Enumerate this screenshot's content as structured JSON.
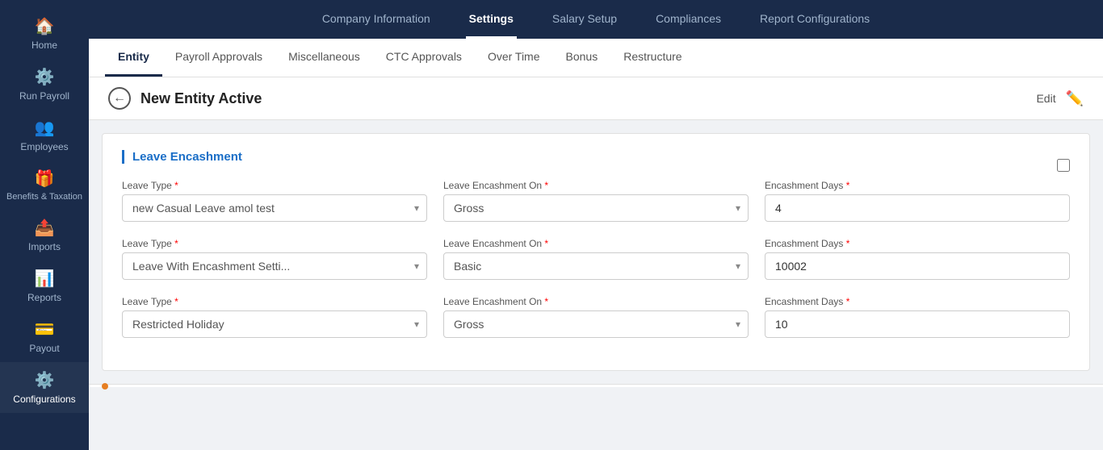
{
  "sidebar": {
    "items": [
      {
        "label": "Home",
        "icon": "🏠",
        "active": false
      },
      {
        "label": "Run Payroll",
        "icon": "⚙️",
        "active": false
      },
      {
        "label": "Employees",
        "icon": "👥",
        "active": false
      },
      {
        "label": "Benefits & Taxation",
        "icon": "🎁",
        "active": false
      },
      {
        "label": "Imports",
        "icon": "📤",
        "active": false
      },
      {
        "label": "Reports",
        "icon": "📊",
        "active": false
      },
      {
        "label": "Payout",
        "icon": "💳",
        "active": false
      },
      {
        "label": "Configurations",
        "icon": "⚙️",
        "active": true
      }
    ]
  },
  "topNav": {
    "items": [
      {
        "label": "Company Information",
        "active": false
      },
      {
        "label": "Settings",
        "active": true
      },
      {
        "label": "Salary Setup",
        "active": false
      },
      {
        "label": "Compliances",
        "active": false
      },
      {
        "label": "Report Configurations",
        "active": false
      }
    ]
  },
  "subNav": {
    "items": [
      {
        "label": "Entity",
        "active": true
      },
      {
        "label": "Payroll Approvals",
        "active": false
      },
      {
        "label": "Miscellaneous",
        "active": false
      },
      {
        "label": "CTC Approvals",
        "active": false
      },
      {
        "label": "Over Time",
        "active": false
      },
      {
        "label": "Bonus",
        "active": false
      },
      {
        "label": "Restructure",
        "active": false
      }
    ]
  },
  "entityHeader": {
    "title": "New Entity Active",
    "editLabel": "Edit"
  },
  "leaveEncashment": {
    "title": "Leave Encashment",
    "rows": [
      {
        "leaveTypeLabel": "Leave Type",
        "leaveTypeValue": "new Casual Leave amol test",
        "encashmentOnLabel": "Leave Encashment On",
        "encashmentOnValue": "Gross",
        "encashmentDaysLabel": "Encashment Days",
        "encashmentDaysValue": "4"
      },
      {
        "leaveTypeLabel": "Leave Type",
        "leaveTypeValue": "Leave With Encashment Setti...",
        "encashmentOnLabel": "Leave Encashment On",
        "encashmentOnValue": "Basic",
        "encashmentDaysLabel": "Encashment Days",
        "encashmentDaysValue": "10002"
      },
      {
        "leaveTypeLabel": "Leave Type",
        "leaveTypeValue": "Restricted Holiday",
        "encashmentOnLabel": "Leave Encashment On",
        "encashmentOnValue": "Gross",
        "encashmentDaysLabel": "Encashment Days",
        "encashmentDaysValue": "10"
      }
    ]
  }
}
